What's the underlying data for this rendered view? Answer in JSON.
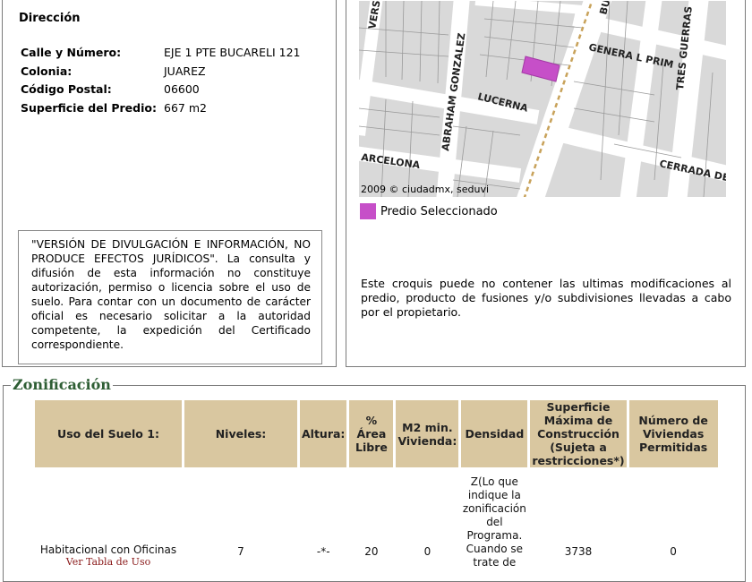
{
  "direccion": {
    "title": "Dirección",
    "rows": [
      {
        "label": "Calle y Número:",
        "value": "EJE 1 PTE BUCARELI 121"
      },
      {
        "label": "Colonia:",
        "value": "JUAREZ"
      },
      {
        "label": "Código Postal:",
        "value": "06600"
      },
      {
        "label": "Superficie del Predio:",
        "value": "667 m2"
      }
    ]
  },
  "disclaimer": "\"VERSIÓN DE DIVULGACIÓN E INFORMACIÓN, NO PRODUCE EFECTOS JURÍDICOS\". La consulta y difusión de esta información no constituye autorización, permiso o licencia sobre el uso de suelo. Para contar con un documento de carácter oficial es necesario solicitar a la autoridad competente, la expedición del Certificado correspondiente.",
  "map": {
    "streets": [
      "VERSA",
      "BU",
      "GENERA L PRIM",
      "TRES GUERRAS",
      "ABRAHAM GONZALEZ",
      "LUCERNA",
      "ARCELONA",
      "CERRADA DE"
    ],
    "copyright": "2009 © ciudadmx, seduvi",
    "legend_label": "Predio Seleccionado",
    "legend_color": "#c64fc8",
    "note": "Este croquis puede no contener las ultimas modificaciones al predio, producto de fusiones y/o subdivisiones llevadas a cabo por el propietario."
  },
  "zonificacion": {
    "title": "Zonificación",
    "headers": [
      "Uso del Suelo 1:",
      "Niveles:",
      "Altura:",
      "% Área Libre",
      "M2 min. Vivienda:",
      "Densidad",
      "Superficie Máxima de Construcción (Sujeta a restricciones*)",
      "Número de Viviendas Permitidas"
    ],
    "row": {
      "uso": "Habitacional con Oficinas",
      "uso_link": "Ver Tabla de Uso",
      "niveles": "7",
      "altura": "-*-",
      "area_libre": "20",
      "m2_min": "0",
      "densidad": "Z(Lo que indique la zonificación del Programa. Cuando se trate de",
      "superficie": "3738",
      "viviendas": "0"
    }
  }
}
